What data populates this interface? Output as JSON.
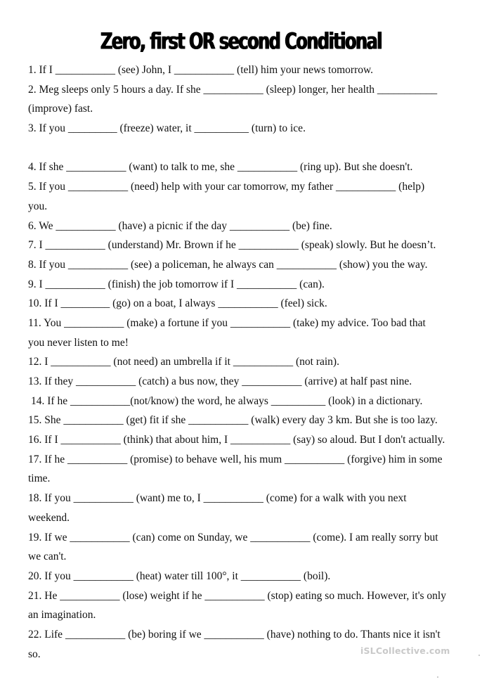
{
  "document": {
    "title": "Zero, first OR second Conditional",
    "lines": [
      {
        "id": "l1",
        "text": "1. If I ___________ (see) John, I ___________ (tell) him your news tomorrow."
      },
      {
        "id": "l2",
        "text": "2. Meg sleeps only 5 hours a day. If she ___________ (sleep) longer, her health ___________"
      },
      {
        "id": "l3",
        "text": "(improve) fast."
      },
      {
        "id": "l4",
        "text": "3. If you _________ (freeze) water, it __________ (turn) to ice."
      },
      {
        "id": "l5",
        "text": "4. If she ___________ (want) to talk to me, she ___________ (ring up). But she doesn't."
      },
      {
        "id": "l6",
        "text": "5. If you ___________ (need) help with your car tomorrow, my father ___________ (help)"
      },
      {
        "id": "l7",
        "text": "you."
      },
      {
        "id": "l8",
        "text": "6. We ___________ (have) a picnic if the day ___________ (be) fine."
      },
      {
        "id": "l9",
        "text": "7. I ___________ (understand) Mr. Brown if he ___________ (speak) slowly. But he doesn’t."
      },
      {
        "id": "l10",
        "text": "8. If you ___________ (see) a policeman, he always can ___________ (show) you the way."
      },
      {
        "id": "l11",
        "text": "9. I ___________ (finish) the job tomorrow if I ___________ (can)."
      },
      {
        "id": "l12",
        "text": "10. If I _________ (go) on a boat, I always ___________ (feel) sick."
      },
      {
        "id": "l13",
        "text": "11. You ___________ (make) a fortune if you ___________ (take) my advice. Too bad that"
      },
      {
        "id": "l14",
        "text": "you never listen to me!"
      },
      {
        "id": "l15",
        "text": "12. I ___________ (not need) an umbrella if it ___________ (not rain)."
      },
      {
        "id": "l16",
        "text": "13. If they ___________ (catch) a bus now, they ___________ (arrive) at half past nine."
      },
      {
        "id": "l17",
        "text": "14.  If he ___________(not/know) the word, he always __________ (look) in a dictionary."
      },
      {
        "id": "l18",
        "text": "15. She ___________ (get) fit if she ___________ (walk) every day 3 km. But she is too lazy."
      },
      {
        "id": "l19",
        "text": "16. If I ___________ (think) that about him, I ___________ (say) so aloud. But I don't actually."
      },
      {
        "id": "l20",
        "text": "17. If he ___________ (promise) to behave well, his mum ___________ (forgive) him in some"
      },
      {
        "id": "l21",
        "text": "time."
      },
      {
        "id": "l22",
        "text": "18. If you ___________ (want) me to, I ___________ (come) for a walk with you next"
      },
      {
        "id": "l23",
        "text": "weekend."
      },
      {
        "id": "l24",
        "text": "19. If we ___________ (can) come on Sunday, we ___________ (come). I am really sorry but"
      },
      {
        "id": "l25",
        "text": "we can't."
      },
      {
        "id": "l26",
        "text": "20. If you ___________ (heat) water till 100°, it ___________ (boil)."
      },
      {
        "id": "l27",
        "text": "21. He ___________ (lose) weight if he ___________ (stop) eating so much. However, it's only"
      },
      {
        "id": "l28",
        "text": "an imagination."
      },
      {
        "id": "l29",
        "text": "22. Life ___________ (be) boring if we ___________ (have) nothing to do. Thants nice it isn't"
      },
      {
        "id": "l30",
        "text": "so."
      }
    ],
    "watermark": "iSLCollective.com"
  }
}
